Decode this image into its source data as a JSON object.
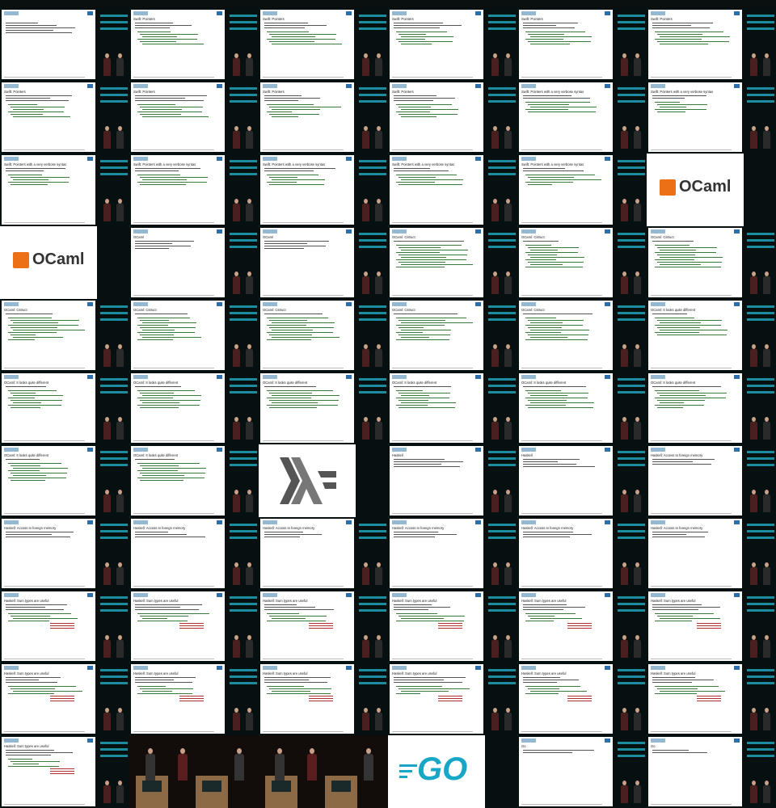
{
  "grid": {
    "cols": 6,
    "rows": 11
  },
  "cells": [
    {
      "kind": "slide",
      "title": "",
      "lines": 5,
      "code": 0
    },
    {
      "kind": "slide",
      "title": "Swift: Pointers",
      "lines": 3,
      "code": 6
    },
    {
      "kind": "slide",
      "title": "Swift: Pointers",
      "lines": 3,
      "code": 6
    },
    {
      "kind": "slide",
      "title": "Swift: Pointers",
      "lines": 3,
      "code": 6
    },
    {
      "kind": "slide",
      "title": "Swift: Pointers",
      "lines": 3,
      "code": 6
    },
    {
      "kind": "slide",
      "title": "Swift: Pointers",
      "lines": 3,
      "code": 6
    },
    {
      "kind": "slide",
      "title": "Swift: Pointers",
      "lines": 3,
      "code": 6
    },
    {
      "kind": "slide",
      "title": "Swift: Pointers",
      "lines": 3,
      "code": 6
    },
    {
      "kind": "slide",
      "title": "Swift: Pointers",
      "lines": 3,
      "code": 6
    },
    {
      "kind": "slide",
      "title": "Swift: Pointers",
      "lines": 3,
      "code": 6
    },
    {
      "kind": "slide",
      "title": "Swift: Pointers with a very verbose syntax",
      "lines": 2,
      "code": 5
    },
    {
      "kind": "slide",
      "title": "Swift: Pointers with a very verbose syntax",
      "lines": 2,
      "code": 5
    },
    {
      "kind": "slide",
      "title": "Swift: Pointers with a very verbose syntax",
      "lines": 2,
      "code": 5
    },
    {
      "kind": "slide",
      "title": "Swift: Pointers with a very verbose syntax",
      "lines": 2,
      "code": 5
    },
    {
      "kind": "slide",
      "title": "Swift: Pointers with a very verbose syntax",
      "lines": 2,
      "code": 5
    },
    {
      "kind": "slide",
      "title": "Swift: Pointers with a very verbose syntax",
      "lines": 2,
      "code": 5
    },
    {
      "kind": "slide",
      "title": "Swift: Pointers with a very verbose syntax",
      "lines": 2,
      "code": 5
    },
    {
      "kind": "ocaml",
      "text": "OCaml"
    },
    {
      "kind": "ocaml",
      "text": "OCaml"
    },
    {
      "kind": "slide",
      "title": "OCaml",
      "lines": 4,
      "code": 0
    },
    {
      "kind": "slide",
      "title": "OCaml",
      "lines": 4,
      "code": 0
    },
    {
      "kind": "slide",
      "title": "OCaml: Cstruct",
      "lines": 1,
      "code": 10
    },
    {
      "kind": "slide",
      "title": "OCaml: Cstruct",
      "lines": 1,
      "code": 10
    },
    {
      "kind": "slide",
      "title": "OCaml: Cstruct",
      "lines": 1,
      "code": 10
    },
    {
      "kind": "slide",
      "title": "OCaml: Cstruct",
      "lines": 1,
      "code": 10
    },
    {
      "kind": "slide",
      "title": "OCaml: Cstruct",
      "lines": 1,
      "code": 10
    },
    {
      "kind": "slide",
      "title": "OCaml: Cstruct",
      "lines": 1,
      "code": 10
    },
    {
      "kind": "slide",
      "title": "OCaml: Cstruct",
      "lines": 1,
      "code": 10
    },
    {
      "kind": "slide",
      "title": "OCaml: Cstruct",
      "lines": 1,
      "code": 10
    },
    {
      "kind": "slide",
      "title": "OCaml: It looks quite different",
      "lines": 1,
      "code": 8
    },
    {
      "kind": "slide",
      "title": "OCaml: It looks quite different",
      "lines": 1,
      "code": 8
    },
    {
      "kind": "slide",
      "title": "OCaml: It looks quite different",
      "lines": 1,
      "code": 8
    },
    {
      "kind": "slide",
      "title": "OCaml: It looks quite different",
      "lines": 1,
      "code": 8
    },
    {
      "kind": "slide",
      "title": "OCaml: It looks quite different",
      "lines": 1,
      "code": 8
    },
    {
      "kind": "slide",
      "title": "OCaml: It looks quite different",
      "lines": 1,
      "code": 8
    },
    {
      "kind": "slide",
      "title": "OCaml: It looks quite different",
      "lines": 1,
      "code": 8
    },
    {
      "kind": "slide",
      "title": "OCaml: It looks quite different",
      "lines": 1,
      "code": 8
    },
    {
      "kind": "slide",
      "title": "OCaml: It looks quite different",
      "lines": 1,
      "code": 8
    },
    {
      "kind": "haskell"
    },
    {
      "kind": "slide",
      "title": "Haskell",
      "lines": 4,
      "code": 0
    },
    {
      "kind": "slide",
      "title": "Haskell",
      "lines": 4,
      "code": 0
    },
    {
      "kind": "slide",
      "title": "Haskell: Access to foreign memory",
      "lines": 3,
      "code": 0
    },
    {
      "kind": "slide",
      "title": "Haskell: Access to foreign memory",
      "lines": 3,
      "code": 0
    },
    {
      "kind": "slide",
      "title": "Haskell: Access to foreign memory",
      "lines": 3,
      "code": 0
    },
    {
      "kind": "slide",
      "title": "Haskell: Access to foreign memory",
      "lines": 3,
      "code": 0
    },
    {
      "kind": "slide",
      "title": "Haskell: Access to foreign memory",
      "lines": 3,
      "code": 0
    },
    {
      "kind": "slide",
      "title": "Haskell: Access to foreign memory",
      "lines": 3,
      "code": 0
    },
    {
      "kind": "slide",
      "title": "Haskell: Access to foreign memory",
      "lines": 3,
      "code": 0
    },
    {
      "kind": "slide",
      "title": "Haskell: Sum types are useful",
      "lines": 3,
      "code": 4,
      "red": true
    },
    {
      "kind": "slide",
      "title": "Haskell: Sum types are useful",
      "lines": 3,
      "code": 4,
      "red": true
    },
    {
      "kind": "slide",
      "title": "Haskell: Sum types are useful",
      "lines": 3,
      "code": 4,
      "red": true
    },
    {
      "kind": "slide",
      "title": "Haskell: Sum types are useful",
      "lines": 3,
      "code": 4,
      "red": true
    },
    {
      "kind": "slide",
      "title": "Haskell: Sum types are useful",
      "lines": 3,
      "code": 4,
      "red": true
    },
    {
      "kind": "slide",
      "title": "Haskell: Sum types are useful",
      "lines": 3,
      "code": 4,
      "red": true
    },
    {
      "kind": "slide",
      "title": "Haskell: Sum types are useful",
      "lines": 3,
      "code": 4,
      "red": true
    },
    {
      "kind": "slide",
      "title": "Haskell: Sum types are useful",
      "lines": 3,
      "code": 4,
      "red": true
    },
    {
      "kind": "slide",
      "title": "Haskell: Sum types are useful",
      "lines": 3,
      "code": 4,
      "red": true
    },
    {
      "kind": "slide",
      "title": "Haskell: Sum types are useful",
      "lines": 3,
      "code": 4,
      "red": true
    },
    {
      "kind": "slide",
      "title": "Haskell: Sum types are useful",
      "lines": 3,
      "code": 4,
      "red": true
    },
    {
      "kind": "slide",
      "title": "Haskell: Sum types are useful",
      "lines": 3,
      "code": 4,
      "red": true
    },
    {
      "kind": "slide",
      "title": "Haskell: Sum types are useful",
      "lines": 3,
      "code": 4,
      "red": true
    },
    {
      "kind": "stage"
    },
    {
      "kind": "stage"
    },
    {
      "kind": "go",
      "text": "GO"
    },
    {
      "kind": "slide",
      "title": "Go",
      "lines": 2,
      "code": 0
    },
    {
      "kind": "slide",
      "title": "Go",
      "lines": 2,
      "code": 0
    }
  ]
}
